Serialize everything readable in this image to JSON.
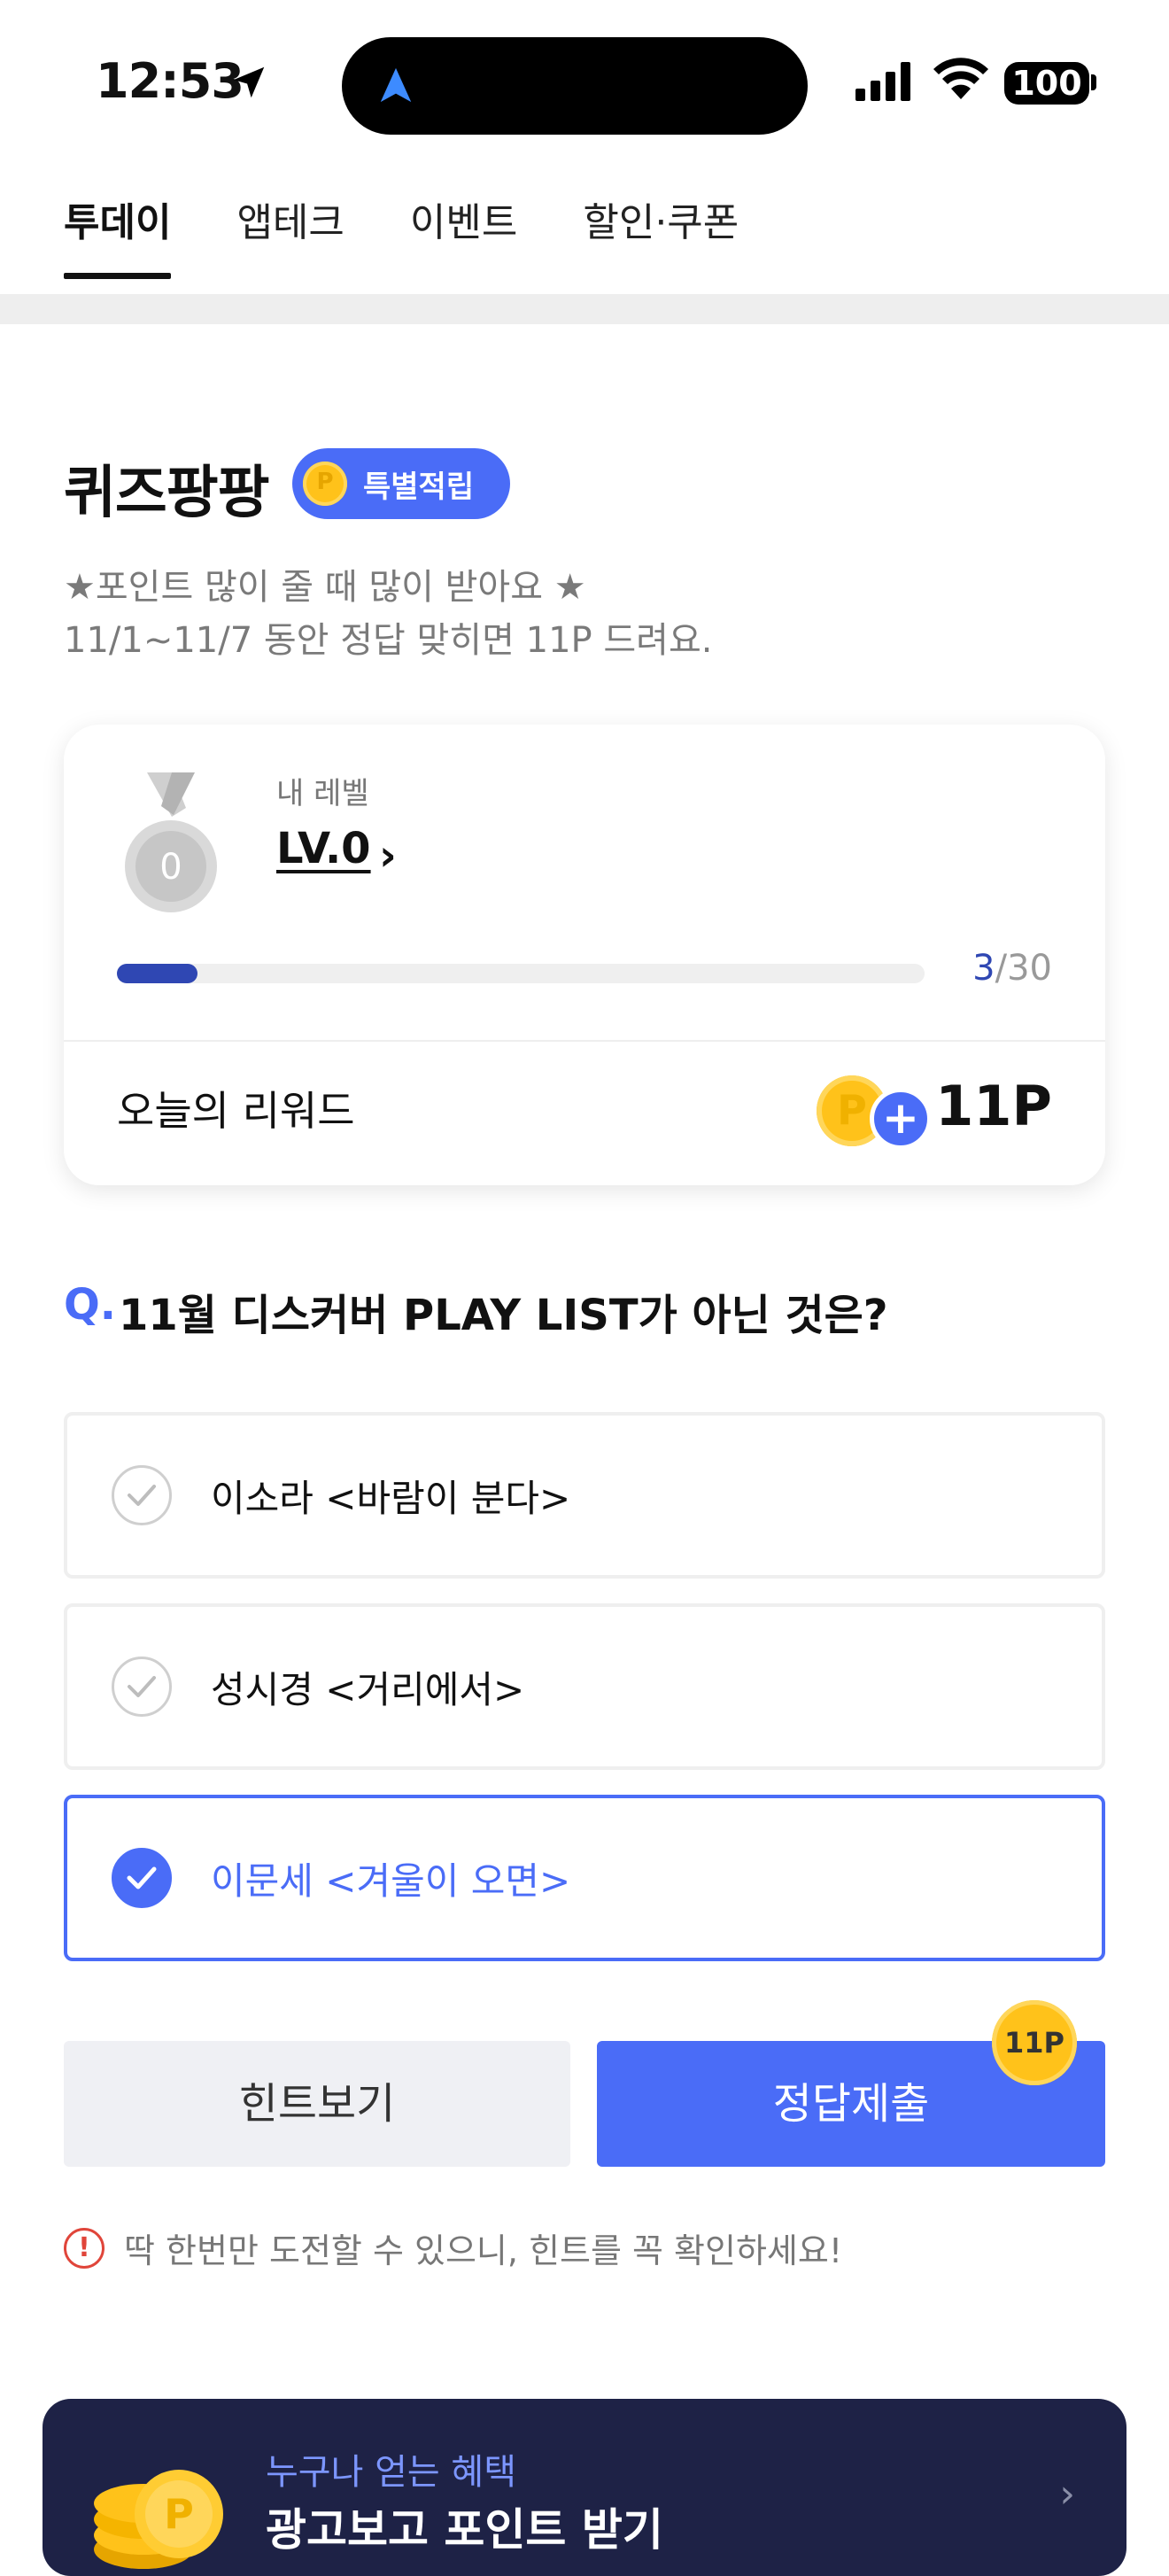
{
  "status": {
    "time": "12:53",
    "battery": "100"
  },
  "tabs": [
    {
      "label": "투데이",
      "active": true
    },
    {
      "label": "앱테크",
      "active": false
    },
    {
      "label": "이벤트",
      "active": false
    },
    {
      "label": "할인·쿠폰",
      "active": false
    }
  ],
  "header": {
    "title": "퀴즈팡팡",
    "badge_label": "특별적립",
    "coin_letter": "P",
    "desc_line1": "★포인트 많이 줄 때 많이 받아요 ★",
    "desc_line2": "11/1~11/7 동안 정답 맞히면 11P 드려요."
  },
  "level_card": {
    "medal_number": "0",
    "label": "내 레벨",
    "value": "LV.0",
    "progress_current": "3",
    "progress_total": "/30",
    "progress_fraction": 0.1,
    "reward_label": "오늘의 리워드",
    "reward_value": "11P",
    "coin_letter": "P"
  },
  "question": {
    "prefix": "Q.",
    "text": "11월 디스커버 PLAY LIST가 아닌 것은?",
    "options": [
      {
        "label": "이소라 <바람이 분다>",
        "selected": false
      },
      {
        "label": "성시경 <거리에서>",
        "selected": false
      },
      {
        "label": "이문세 <겨울이 오면>",
        "selected": true
      }
    ]
  },
  "actions": {
    "hint_label": "힌트보기",
    "submit_label": "정답제출",
    "submit_badge": "11P"
  },
  "warning": {
    "icon": "!",
    "text": "딱 한번만 도전할 수 있으니, 힌트를 꼭 확인하세요!"
  },
  "banner": {
    "subtitle": "누구나 얻는 혜택",
    "title": "광고보고 포인트 받기"
  },
  "colors": {
    "accent": "#4A6CF7",
    "progress": "#2F47B3",
    "banner_bg": "#1E2246",
    "coin": "#FFC21A"
  }
}
